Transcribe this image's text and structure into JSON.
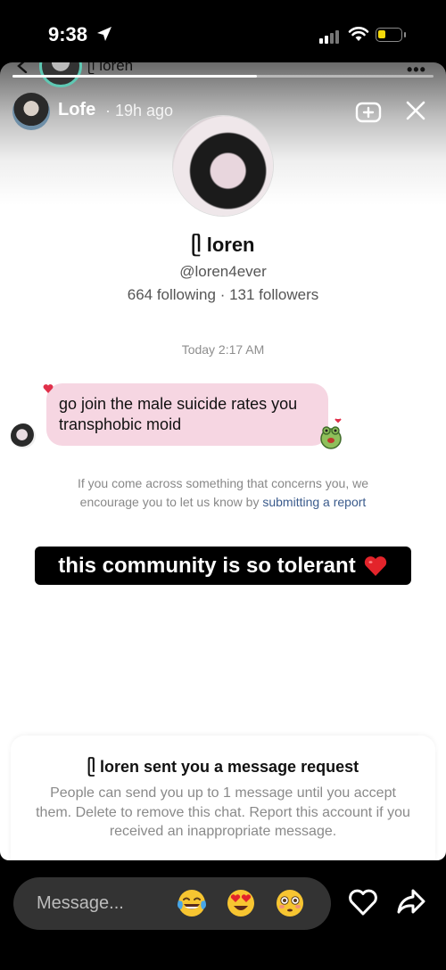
{
  "status_bar": {
    "time": "9:38"
  },
  "underlay": {
    "name": "ᥫ loren"
  },
  "story": {
    "progress": 0.58,
    "poster_name": "Lofe",
    "poster_time": "· 19h ago"
  },
  "profile": {
    "name": "ᥫ loren",
    "handle": "@loren4ever",
    "stats": "664 following · 131 followers"
  },
  "conversation": {
    "timestamp": "Today 2:17 AM",
    "message": "go join the male suicide rates you transphobic moid"
  },
  "report_note": {
    "text": "If you come across something that concerns you, we encourage you to let us know by ",
    "link": "submitting a report"
  },
  "caption": {
    "text": "this community is so tolerant"
  },
  "request": {
    "title": "ᥫ loren sent you a message request",
    "body": "People can send you up to 1 message until you accept them. Delete to remove this chat. Report this account if you received an inappropriate message."
  },
  "reply": {
    "placeholder": "Message...",
    "emojis": [
      "tears-of-joy",
      "heart-eyes",
      "flushed"
    ]
  },
  "colors": {
    "bubble": "#f6d6e2",
    "link": "#3b5b8c",
    "battery": "#f5d90a",
    "ring": "#5fc9b4"
  }
}
